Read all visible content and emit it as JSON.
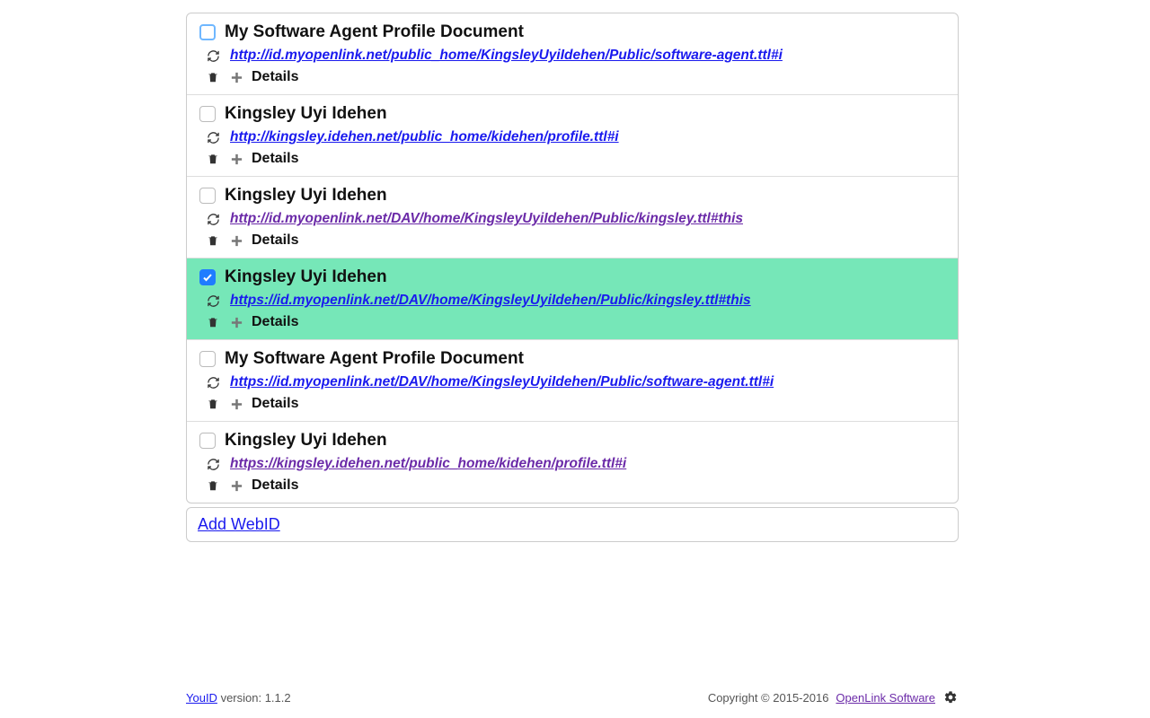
{
  "items": [
    {
      "title": "My Software Agent Profile Document",
      "url": "http://id.myopenlink.net/public_home/KingsleyUyiIdehen/Public/software-agent.ttl#i",
      "link_style": "blue",
      "checked": false,
      "highlight_checkbox": true,
      "details_label": "Details"
    },
    {
      "title": "Kingsley Uyi Idehen",
      "url": "http://kingsley.idehen.net/public_home/kidehen/profile.ttl#i",
      "link_style": "blue",
      "checked": false,
      "highlight_checkbox": false,
      "details_label": "Details"
    },
    {
      "title": "Kingsley Uyi Idehen",
      "url": "http://id.myopenlink.net/DAV/home/KingsleyUyiIdehen/Public/kingsley.ttl#this",
      "link_style": "visited",
      "checked": false,
      "highlight_checkbox": false,
      "details_label": "Details"
    },
    {
      "title": "Kingsley Uyi Idehen",
      "url": "https://id.myopenlink.net/DAV/home/KingsleyUyiIdehen/Public/kingsley.ttl#this",
      "link_style": "blue",
      "checked": true,
      "highlight_checkbox": false,
      "details_label": "Details"
    },
    {
      "title": "My Software Agent Profile Document",
      "url": "https://id.myopenlink.net/DAV/home/KingsleyUyiIdehen/Public/software-agent.ttl#i",
      "link_style": "blue",
      "checked": false,
      "highlight_checkbox": false,
      "details_label": "Details"
    },
    {
      "title": "Kingsley Uyi Idehen",
      "url": "https://kingsley.idehen.net/public_home/kidehen/profile.ttl#i",
      "link_style": "visited",
      "checked": false,
      "highlight_checkbox": false,
      "details_label": "Details"
    }
  ],
  "add_label": "Add WebID",
  "footer": {
    "app_link": "YouID",
    "version_label": "version: 1.1.2",
    "copyright": "Copyright © 2015-2016",
    "company_link": "OpenLink Software"
  }
}
